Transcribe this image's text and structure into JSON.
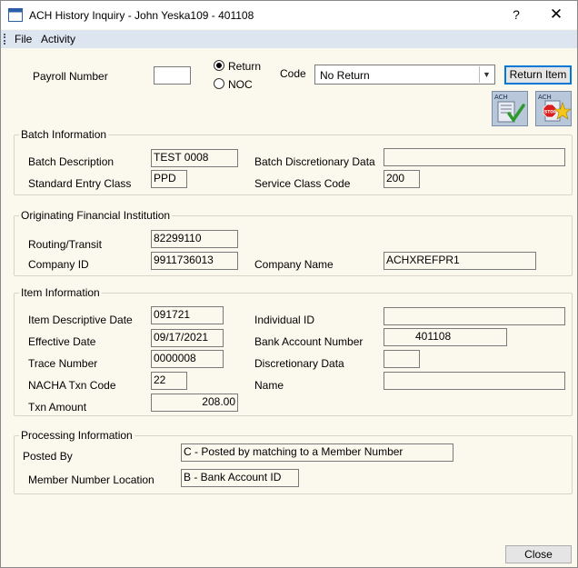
{
  "window": {
    "title": "ACH History Inquiry - John Yeska109 - 401108",
    "help_label": "?",
    "close_glyph": "✕"
  },
  "menu": {
    "items": [
      "File",
      "Activity"
    ]
  },
  "header": {
    "payroll_label": "Payroll Number",
    "payroll_value": "",
    "radio_return": "Return",
    "radio_noc": "NOC",
    "selected_radio": "Return",
    "code_label": "Code",
    "code_value": "No Return",
    "return_button": "Return Item",
    "icon_ach_check": "ACH",
    "icon_ach_stop": "ACH",
    "icon_stop_text": "STOP"
  },
  "batch": {
    "title": "Batch Information",
    "description_label": "Batch Description",
    "description_value": "TEST  0008",
    "discretionary_label": "Batch Discretionary Data",
    "discretionary_value": "",
    "entry_class_label": "Standard Entry Class",
    "entry_class_value": "PPD",
    "service_class_label": "Service Class Code",
    "service_class_value": "200"
  },
  "originating": {
    "title": "Originating Financial Institution",
    "routing_label": "Routing/Transit",
    "routing_value": "82299110",
    "company_id_label": "Company ID",
    "company_id_value": "9911736013",
    "company_name_label": "Company Name",
    "company_name_value": "ACHXREFPR1"
  },
  "item": {
    "title": "Item Information",
    "desc_date_label": "Item Descriptive Date",
    "desc_date_value": "091721",
    "individual_id_label": "Individual ID",
    "individual_id_value": "",
    "effective_date_label": "Effective Date",
    "effective_date_value": "09/17/2021",
    "bank_account_label": "Bank Account Number",
    "bank_account_value": "401108",
    "trace_label": "Trace Number",
    "trace_value": "0000008",
    "discretionary_label": "Discretionary Data",
    "discretionary_value": "",
    "nacha_label": "NACHA Txn Code",
    "nacha_value": "22",
    "name_label": "Name",
    "name_value": "",
    "amount_label": "Txn Amount",
    "amount_value": "208.00"
  },
  "processing": {
    "title": "Processing Information",
    "posted_by_label": "Posted By",
    "posted_by_value": "C - Posted by matching to a Member Number",
    "location_label": "Member Number Location",
    "location_value": "B - Bank Account ID"
  },
  "footer": {
    "close_button": "Close"
  },
  "colors": {
    "panel_bg": "#fbf8ed",
    "menubar_bg": "#dde5f0",
    "focus_blue": "#0078d7",
    "icon_green": "#2e9a2e",
    "icon_red": "#d81e1e",
    "icon_gold": "#f5c518"
  }
}
